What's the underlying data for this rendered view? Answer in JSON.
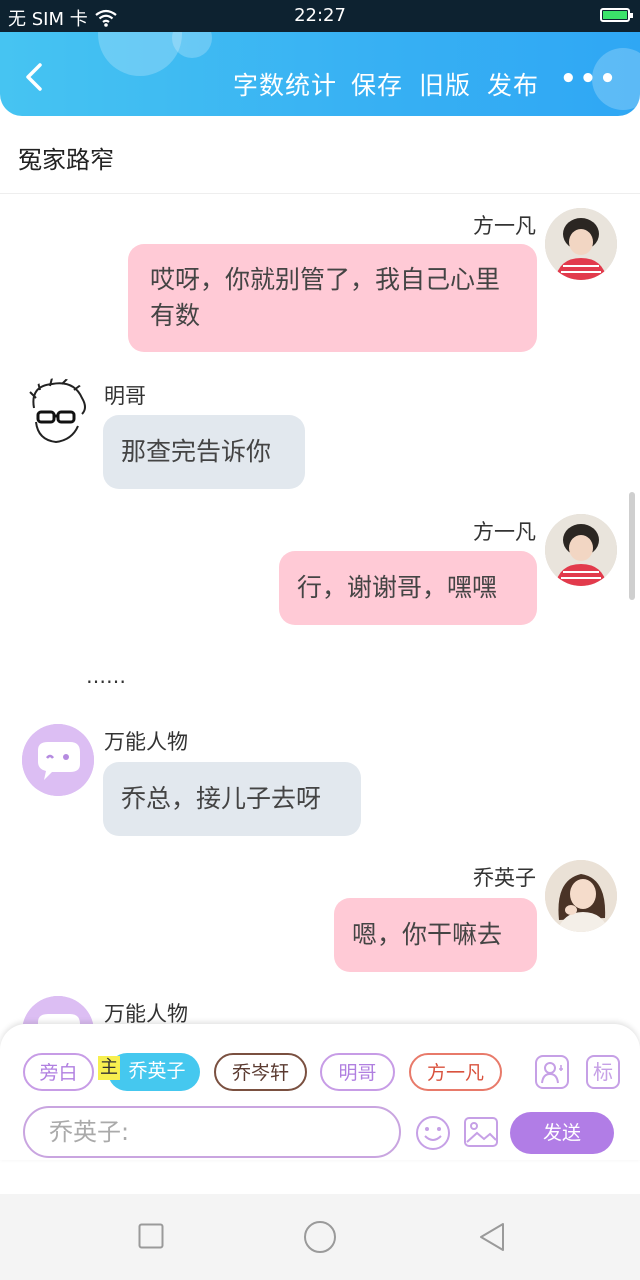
{
  "status_bar": {
    "carrier": "无 SIM 卡",
    "time": "22:27"
  },
  "header": {
    "actions": [
      "字数统计",
      "保存",
      "旧版",
      "发布"
    ],
    "more": "•••"
  },
  "title": "冤家路窄",
  "messages": [
    {
      "speaker": "方一凡",
      "side": "right",
      "text": "哎呀，你就别管了，我自己心里有数"
    },
    {
      "speaker": "明哥",
      "side": "left",
      "text": "那查完告诉你"
    },
    {
      "speaker": "方一凡",
      "side": "right",
      "text": "行，谢谢哥，嘿嘿"
    },
    {
      "narration": "……"
    },
    {
      "speaker": "万能人物",
      "side": "left",
      "text": "乔总，接儿子去呀"
    },
    {
      "speaker": "乔英子",
      "side": "right",
      "text": "嗯，你干嘛去"
    },
    {
      "speaker": "万能人物",
      "side": "left",
      "text": ""
    }
  ],
  "characters": {
    "narrator": "旁白",
    "main_tag": "主",
    "list": [
      "乔英子",
      "乔岑轩",
      "明哥",
      "方一凡"
    ],
    "selected": "乔英子",
    "mark_button": "标"
  },
  "input": {
    "placeholder": "乔英子:",
    "send_label": "发送"
  },
  "colors": {
    "header": "#37b0f3",
    "right_bubble": "#ffcad6",
    "left_bubble": "#e2e8ee",
    "accent_purple": "#b17de6",
    "selected_chip": "#45c8ef"
  }
}
